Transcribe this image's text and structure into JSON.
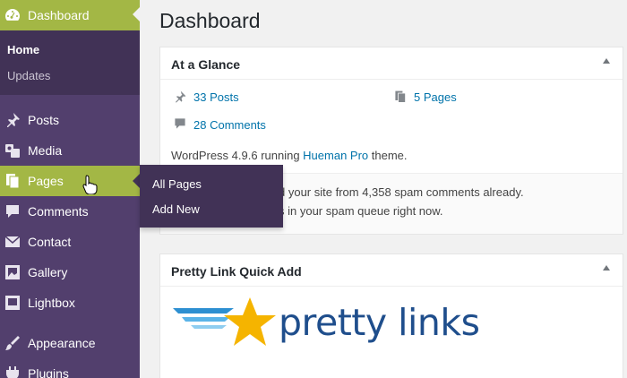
{
  "sidebar": {
    "dashboard": {
      "label": "Dashboard",
      "icon": "dashboard-icon"
    },
    "dashboard_sub": [
      {
        "label": "Home"
      },
      {
        "label": "Updates"
      }
    ],
    "items": [
      {
        "label": "Posts",
        "icon": "pin-icon"
      },
      {
        "label": "Media",
        "icon": "media-icon"
      },
      {
        "label": "Pages",
        "icon": "pages-icon"
      },
      {
        "label": "Comments",
        "icon": "comment-icon"
      },
      {
        "label": "Contact",
        "icon": "mail-icon"
      },
      {
        "label": "Gallery",
        "icon": "gallery-icon"
      },
      {
        "label": "Lightbox",
        "icon": "lightbox-icon"
      },
      {
        "label": "Appearance",
        "icon": "brush-icon"
      },
      {
        "label": "Plugins",
        "icon": "plug-icon"
      }
    ]
  },
  "flyout": {
    "items": [
      {
        "label": "All Pages"
      },
      {
        "label": "Add New"
      }
    ]
  },
  "main": {
    "title": "Dashboard",
    "at_a_glance": {
      "title": "At a Glance",
      "posts": "33 Posts",
      "pages": "5 Pages",
      "comments": "28 Comments",
      "wp_prefix": "WordPress 4.9.6 running ",
      "theme": "Hueman Pro",
      "wp_suffix": " theme.",
      "spam_line1": "d your site from 4,358 spam comments already.",
      "spam_line2": "s in your spam queue right now."
    },
    "pretty_link": {
      "title": "Pretty Link Quick Add",
      "logo_text": "pretty links"
    }
  },
  "colors": {
    "sidebar_bg": "#523f6d",
    "submenu_bg": "#413256",
    "accent": "#a3b745",
    "link": "#0073aa",
    "logo_text": "#1f4e8c",
    "star": "#f5b400"
  }
}
